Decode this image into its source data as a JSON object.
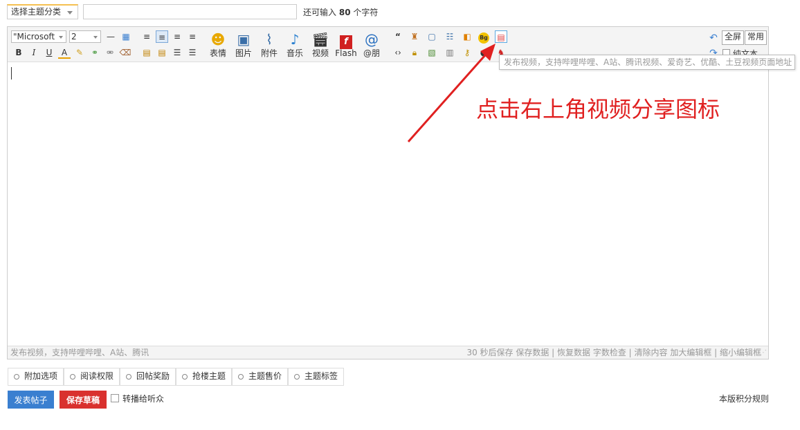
{
  "topbar": {
    "category_select": "选择主题分类",
    "title_value": "",
    "char_hint_prefix": "还可输入",
    "char_hint_count": "80",
    "char_hint_suffix": "个字符"
  },
  "toolbar": {
    "font_family": "\"Microsoft",
    "font_size": "2",
    "media": [
      {
        "label": "表情",
        "icon": "smiley-icon"
      },
      {
        "label": "图片",
        "icon": "image-icon"
      },
      {
        "label": "附件",
        "icon": "paperclip-icon"
      },
      {
        "label": "音乐",
        "icon": "music-note-icon"
      },
      {
        "label": "视频",
        "icon": "film-icon"
      },
      {
        "label": "Flash",
        "icon": "flash-icon"
      },
      {
        "label": "@朋",
        "icon": "at-icon"
      }
    ],
    "fullscreen_label": "全屏",
    "common_label": "常用",
    "plain_text_label": "纯文本",
    "bg_icon_text": "Bg"
  },
  "tooltip": "发布视频，支持哔哩哔哩、A站、腾讯视频、爱奇艺、优酷、土豆视频页面地址",
  "annotation": "点击右上角视频分享图标",
  "statusbar": {
    "left": "发布视频，支持哔哩哔哩、A站、腾讯",
    "right": "30 秒后保存 保存数据 | 恢复数据     字数检查 | 清除内容     加大编辑框 | 缩小编辑框"
  },
  "options": [
    "附加选项",
    "阅读权限",
    "回帖奖励",
    "抢楼主题",
    "主题售价",
    "主题标签"
  ],
  "bottom": {
    "publish": "发表帖子",
    "draft": "保存草稿",
    "forward": "转播给听众",
    "rules": "本版积分规则"
  },
  "colors": {
    "publish_bg": "#3a7fd0",
    "draft_bg": "#d9312e",
    "annotation": "#e02020"
  }
}
